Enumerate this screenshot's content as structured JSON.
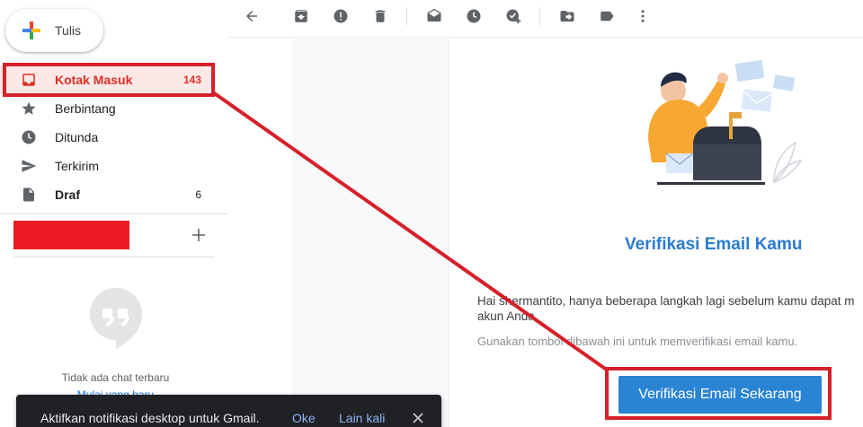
{
  "compose": {
    "label": "Tulis"
  },
  "nav": {
    "items": [
      {
        "label": "Kotak Masuk",
        "count": "143",
        "icon": "inbox-icon",
        "active": true
      },
      {
        "label": "Berbintang",
        "count": "",
        "icon": "star-icon"
      },
      {
        "label": "Ditunda",
        "count": "",
        "icon": "clock-icon"
      },
      {
        "label": "Terkirim",
        "count": "",
        "icon": "send-icon"
      },
      {
        "label": "Draf",
        "count": "6",
        "icon": "draft-icon",
        "bold": true
      }
    ]
  },
  "chat": {
    "empty_text": "Tidak ada chat terbaru",
    "start_link": "Mulai yang baru"
  },
  "toolbar": {
    "icons": [
      "back-icon",
      "archive-icon",
      "report-spam-icon",
      "delete-icon",
      "mark-unread-icon",
      "snooze-icon",
      "add-task-icon",
      "move-to-icon",
      "label-icon",
      "more-icon"
    ]
  },
  "email": {
    "heading": "Verifikasi Email Kamu",
    "paragraph_line1": "Hai shermantito, hanya beberapa langkah lagi sebelum kamu dapat m",
    "paragraph_line2": "akun Anda.",
    "paragraph2": "Gunakan tombol dibawah ini untuk memverifikasi email kamu.",
    "button_label": "Verifikasi Email Sekarang"
  },
  "snackbar": {
    "text": "Aktifkan notifikasi desktop untuk Gmail.",
    "ok_label": "Oke",
    "later_label": "Lain kali"
  },
  "colors": {
    "accent_red": "#d93025",
    "highlight": "#d6202a",
    "button_blue": "#2a84d4",
    "heading_blue": "#2a7bd1"
  }
}
